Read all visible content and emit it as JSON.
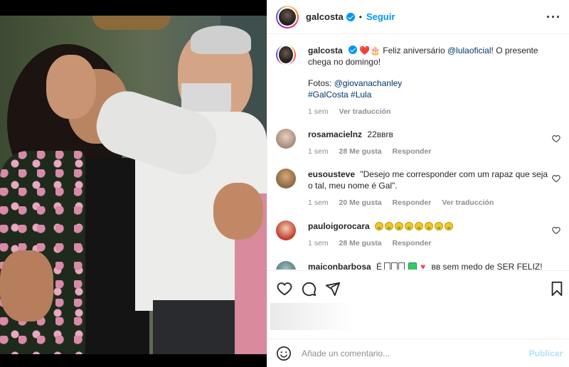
{
  "header": {
    "username": "galcosta",
    "separator": "•",
    "follow_label": "Seguir",
    "more_label": "···"
  },
  "caption": {
    "username": "galcosta",
    "emoji_text": "❤️🎂",
    "text_1": "Feliz aniversário",
    "mention_1": "@lulaoficial",
    "text_2": "! O presente chega no domingo!",
    "photos_label": "Fotos:",
    "mention_2": "@giovanachanley",
    "hashtags": "#GalCosta #Lula",
    "time": "1 sem",
    "translate": "Ver traducción"
  },
  "comments": [
    {
      "username": "rosamacielnz",
      "text": "22ввrв",
      "time": "1 sem",
      "likes": "28 Me gusta",
      "reply": "Responder",
      "translate": ""
    },
    {
      "username": "eusousteve",
      "text": "\"Desejo me corresponder com um rapaz que seja o tal, meu nome é Gal\".",
      "time": "1 sem",
      "likes": "20 Me gusta",
      "reply": "Responder",
      "translate": "Ver traducción"
    },
    {
      "username": "pauloigorocara",
      "text": "",
      "time": "1 sem",
      "likes": "28 Me gusta",
      "reply": "Responder",
      "translate": ""
    },
    {
      "username": "maiconbarbosa",
      "text_1": "É",
      "text_2": "вв sem medo de SER FELIZ!"
    }
  ],
  "add_comment": {
    "placeholder": "Añade un comentario...",
    "publish_label": "Publicar"
  },
  "icons": {
    "like": "heart-icon",
    "comment": "comment-icon",
    "share": "share-icon",
    "save": "bookmark-icon",
    "emoji": "emoji-icon",
    "more": "more-icon"
  },
  "colors": {
    "accent": "#0095f6",
    "verified": "#0095f6",
    "publish_disabled": "#b2dffc",
    "meta_gray": "#8e8e8e",
    "heart_red": "#ed4956"
  }
}
